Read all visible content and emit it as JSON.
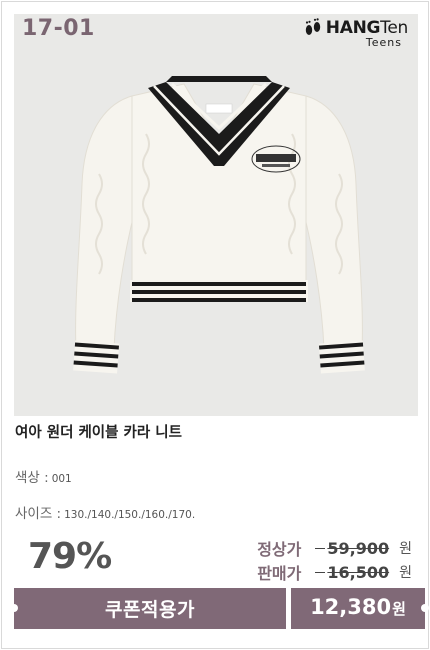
{
  "product": {
    "code": "17-01",
    "brand": {
      "name_bold": "HANG",
      "name_thin": "Ten",
      "sub": "Teens"
    },
    "title": "여아 원더 케이블 카라 니트",
    "options": {
      "color_label": "색상 :",
      "color_value": "001",
      "size_label": "사이즈 :",
      "size_value": "130./140./150./160./170."
    },
    "discount_rate": "79%",
    "regular": {
      "label": "정상가",
      "amount": "59,900",
      "unit": "원"
    },
    "sale": {
      "label": "판매가",
      "amount": "16,500",
      "unit": "원"
    },
    "coupon": {
      "label": "쿠폰적용가",
      "amount": "12,380",
      "unit": "원"
    }
  },
  "icons": {
    "brand_logo": "footprints-icon"
  },
  "colors": {
    "accent": "#806977",
    "photo_bg": "#e9e9e7"
  }
}
